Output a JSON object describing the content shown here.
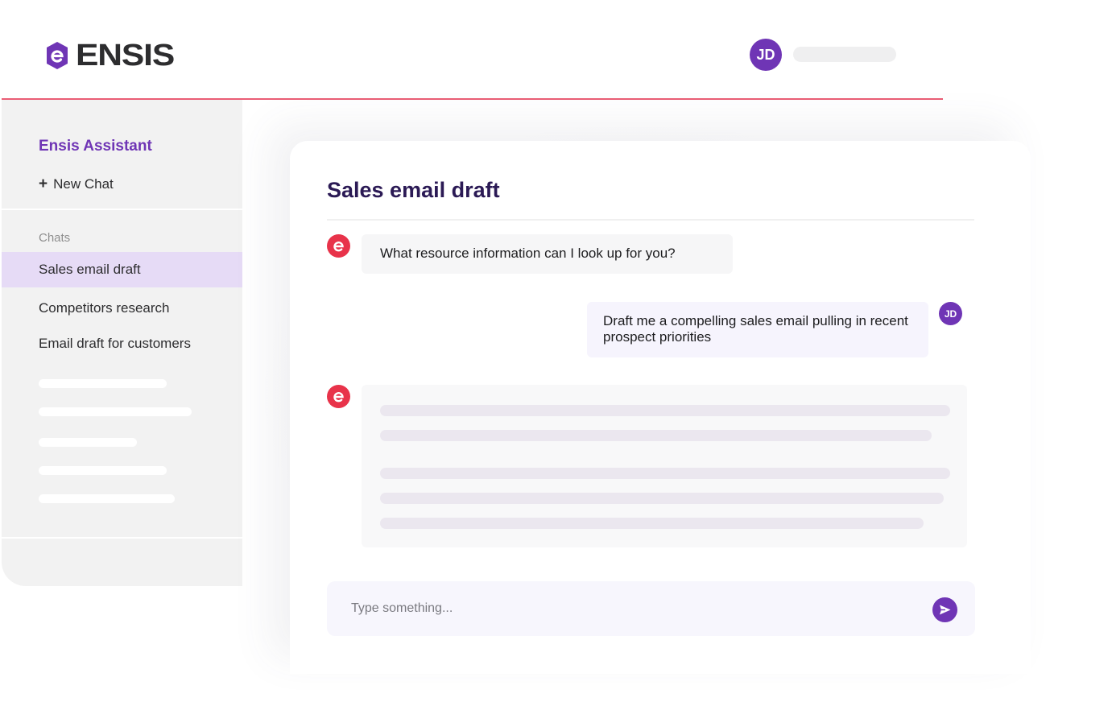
{
  "header": {
    "logo_text": "ENSIS",
    "user_initials": "JD"
  },
  "sidebar": {
    "title": "Ensis Assistant",
    "new_chat_icon": "+",
    "new_chat_label": "New Chat",
    "chats_label": "Chats",
    "items": [
      {
        "label": "Sales email draft",
        "active": true
      },
      {
        "label": "Competitors research",
        "active": false
      },
      {
        "label": "Email draft for customers",
        "active": false
      }
    ]
  },
  "chat": {
    "title": "Sales email draft",
    "messages": [
      {
        "role": "assistant",
        "text": "What resource information can I look up for you?"
      },
      {
        "role": "user",
        "initials": "JD",
        "text": "Draft me a compelling sales email pulling in recent prospect priorities"
      },
      {
        "role": "assistant",
        "loading": true
      }
    ],
    "composer": {
      "placeholder": "Type something...",
      "value": ""
    }
  },
  "icons": {
    "logo": "ensis-logo-icon",
    "assistant_avatar": "ensis-e-icon",
    "send": "send-arrow-icon"
  },
  "colors": {
    "brand_purple": "#6f35b5",
    "brand_red": "#e8334a",
    "divider_pink": "#ea5d75",
    "title_navy": "#2b1a55",
    "active_item_bg": "#e6dbf6"
  }
}
